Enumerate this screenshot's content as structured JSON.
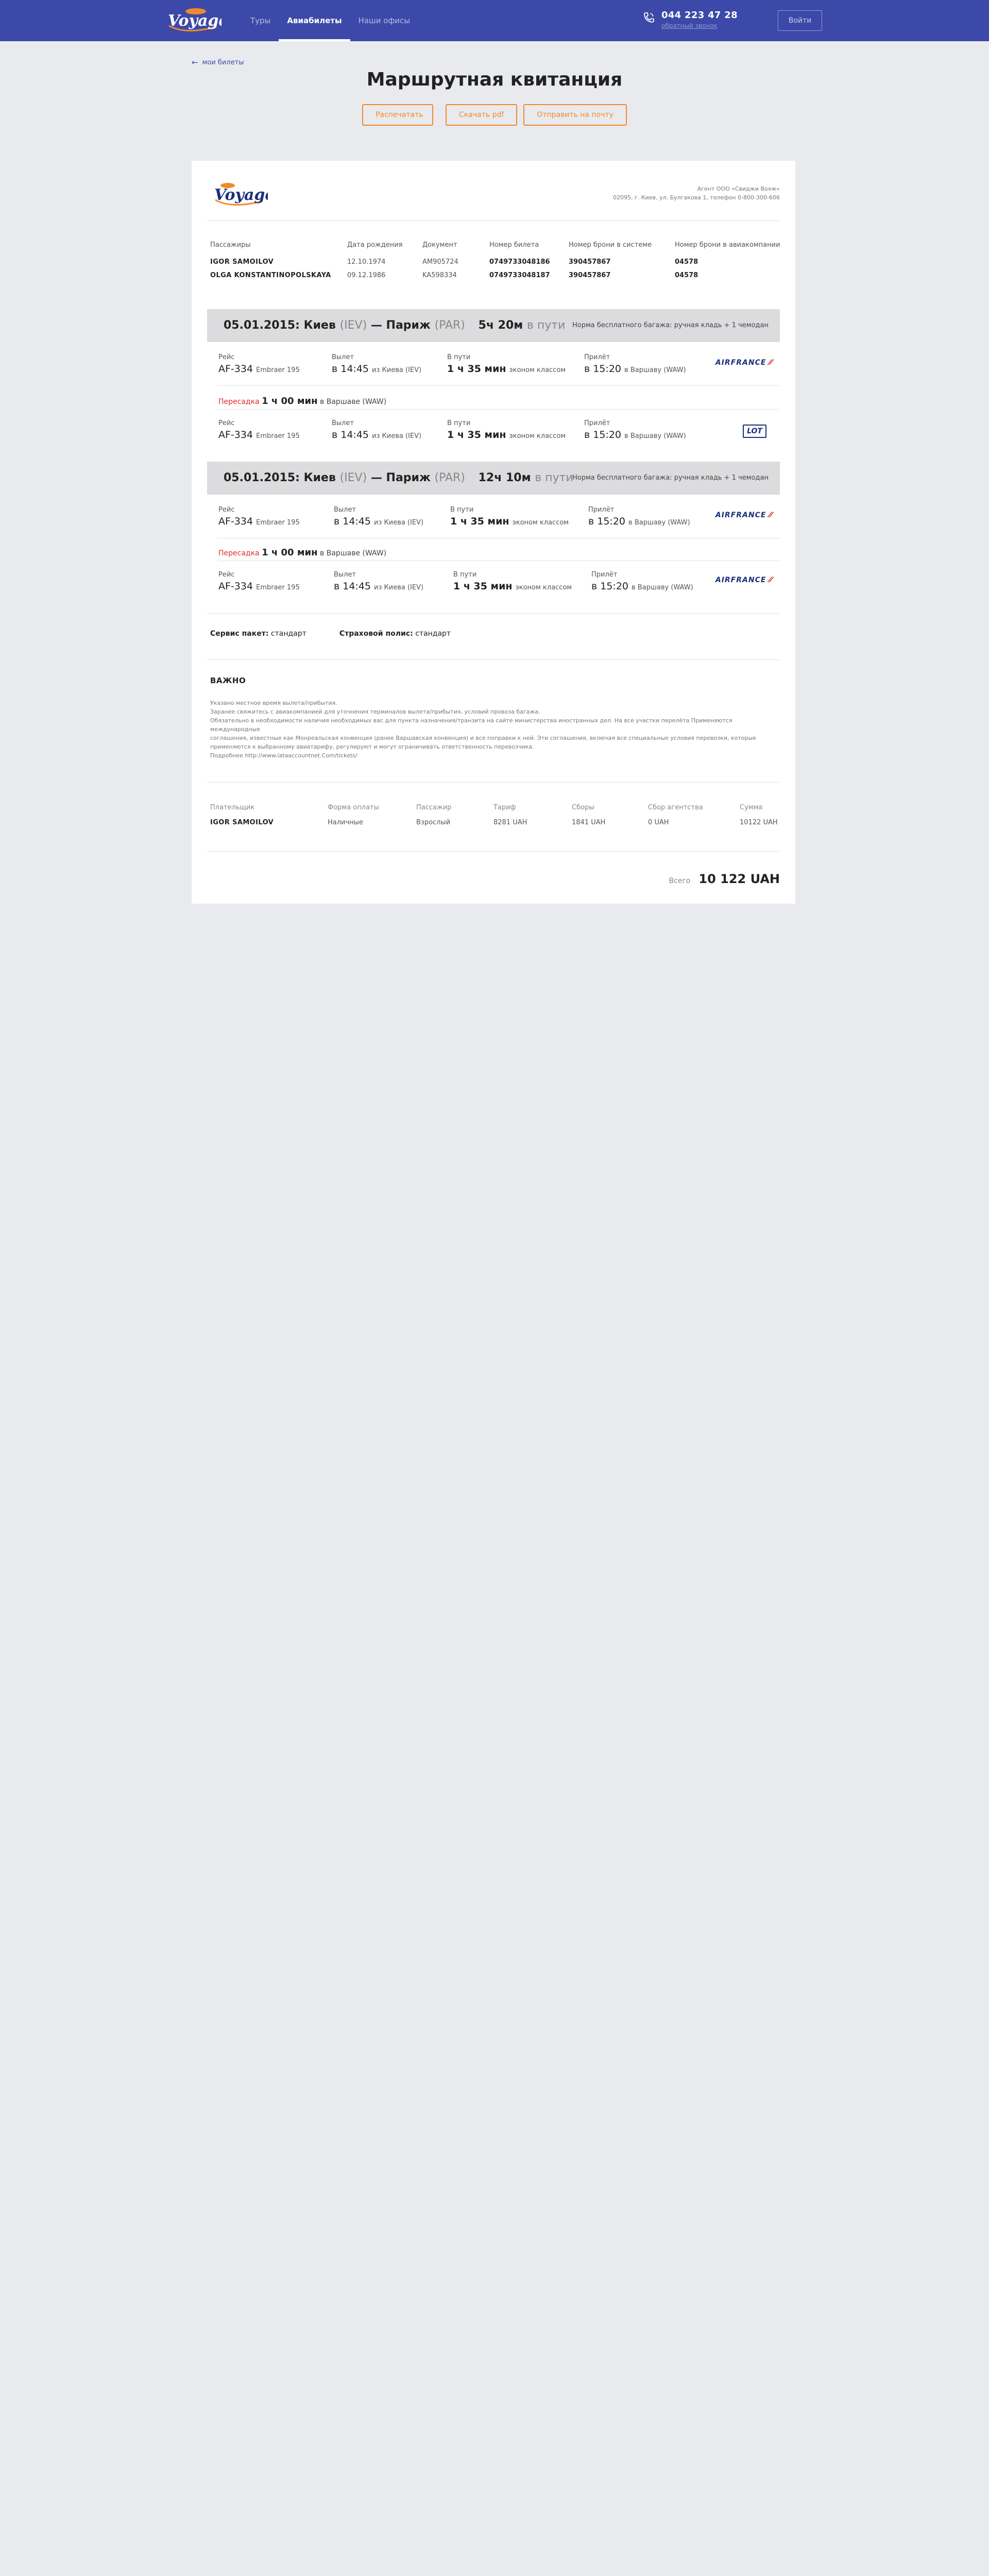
{
  "header": {
    "logo_text": "Voyage",
    "nav": [
      "Туры",
      "Авиабилеты",
      "Наши офисы"
    ],
    "phone": "044 223 47 28",
    "callback": "обратный звонок",
    "login": "Войти"
  },
  "back_link": "мои билеты",
  "title": "Маршрутная квитанция",
  "actions": {
    "print": "Распечатать",
    "pdf": "Скачать pdf",
    "email": "Отправить на почту"
  },
  "agency": {
    "line1": "Агент ООО «Свиджи Вояж»",
    "line2": "02095, г. Киев, ул. Булгакова 1, телефон 0-800-300-606"
  },
  "passengers": {
    "headers": [
      "Пассажиры",
      "Дата рождения",
      "Документ",
      "Номер билета",
      "Номер брони в системе",
      "Номер брони в авиакомпании"
    ],
    "rows": [
      [
        "IGOR SAMOILOV",
        "12.10.1974",
        "AM905724",
        "0749733048186",
        "390457867",
        "04578"
      ],
      [
        "OLGA KONSTANTINOPOLSKAYA",
        "09.12.1986",
        "KA598334",
        "0749733048187",
        "390457867",
        "04578"
      ]
    ]
  },
  "segments": [
    {
      "date": "05.01.2015:",
      "from": "Киев",
      "from_code": "(IEV)",
      "dash": "—",
      "to": "Париж",
      "to_code": "(PAR)",
      "duration": "5ч 20м",
      "duration_suffix": "в пути",
      "baggage": "Норма бесплатного багажа: ручная кладь + 1 чемодан",
      "flights": [
        {
          "label_flight": "Рейс",
          "flight": "AF-334",
          "aircraft": "Embraer 195",
          "label_dep": "Вылет",
          "dep_time": "в 14:45",
          "dep_place": "из Киева (IEV)",
          "label_dur": "В пути",
          "dur": "1 ч 35 мин",
          "cabin": "эконом классом",
          "label_arr": "Прилёт",
          "arr_time": "в 15:20",
          "arr_place": "в Варшаву (WAW)",
          "airline": "AIRFRANCE"
        },
        {
          "label_flight": "Рейс",
          "flight": "AF-334",
          "aircraft": "Embraer 195",
          "label_dep": "Вылет",
          "dep_time": "в 14:45",
          "dep_place": "из Киева (IEV)",
          "label_dur": "В пути",
          "dur": "1 ч 35 мин",
          "cabin": "эконом классом",
          "label_arr": "Прилёт",
          "arr_time": "в 15:20",
          "arr_place": "в Варшаву (WAW)",
          "airline": "LOT"
        }
      ],
      "transfer": {
        "label": "Пересадка",
        "time": "1 ч 00 мин",
        "place": "в Варшаве (WAW)"
      }
    },
    {
      "date": "05.01.2015:",
      "from": "Киев",
      "from_code": "(IEV)",
      "dash": "—",
      "to": "Париж",
      "to_code": "(PAR)",
      "duration": "12ч 10м",
      "duration_suffix": "в пути",
      "baggage": "Норма бесплатного багажа: ручная кладь + 1 чемодан",
      "flights": [
        {
          "label_flight": "Рейс",
          "flight": "AF-334",
          "aircraft": "Embraer 195",
          "label_dep": "Вылет",
          "dep_time": "в 14:45",
          "dep_place": "из Киева (IEV)",
          "label_dur": "В пути",
          "dur": "1 ч 35 мин",
          "cabin": "эконом классом",
          "label_arr": "Прилёт",
          "arr_time": "в 15:20",
          "arr_place": "в Варшаву (WAW)",
          "airline": "AIRFRANCE"
        },
        {
          "label_flight": "Рейс",
          "flight": "AF-334",
          "aircraft": "Embraer 195",
          "label_dep": "Вылет",
          "dep_time": "в 14:45",
          "dep_place": "из Киева (IEV)",
          "label_dur": "В пути",
          "dur": "1 ч 35 мин",
          "cabin": "эконом классом",
          "label_arr": "Прилёт",
          "arr_time": "в 15:20",
          "arr_place": "в Варшаву (WAW)",
          "airline": "AIRFRANCE"
        }
      ],
      "transfer": {
        "label": "Пересадка",
        "time": "1 ч 00 мин",
        "place": "в Варшаве (WAW)"
      }
    }
  ],
  "extras": {
    "service_label": "Сервис пакет:",
    "service_value": "стандарт",
    "insurance_label": "Страховой полис:",
    "insurance_value": "стандарт"
  },
  "important": {
    "title": "ВАЖНО",
    "lines": [
      "Указано местное время вылета/прибытия.",
      "Заранее свяжитесь с авиакомпанией для уточнения терминалов вылета/прибытия, условий провоза багажа.",
      "Обязательно в необходимости наличия необходимых вас для пункта назначения/транзита на сайте министерства иностранных дел. На все участки перелёта Применяются международные",
      "соглашения, известные как Монреальская конвенция (ранее Варшавская конвенция) и все поправки к ней. Эти соглашения, включая все специальные условия перевозки, которые",
      "применяются к выбранному авиатарифу, регулируют и могут ограничивать ответственность перевозчика.",
      "Подробнее http://www.lataaccountnet.Com/tickets/"
    ]
  },
  "payment": {
    "headers": [
      "Плательщик",
      "Форма оплаты",
      "Пассажир",
      "Тариф",
      "Сборы",
      "Сбор агентства",
      "Сумма"
    ],
    "row": [
      "IGOR SAMOILOV",
      "Наличные",
      "Взрослый",
      "8281 UAH",
      "1841 UAH",
      "0 UAH",
      "10122 UAH"
    ]
  },
  "total": {
    "label": "Всего",
    "value": "10 122 UAH"
  },
  "colors": {
    "header": "#3d49a8",
    "accent": "#f08a2c",
    "transfer": "#e12a2a",
    "background": "#e9eaee"
  }
}
